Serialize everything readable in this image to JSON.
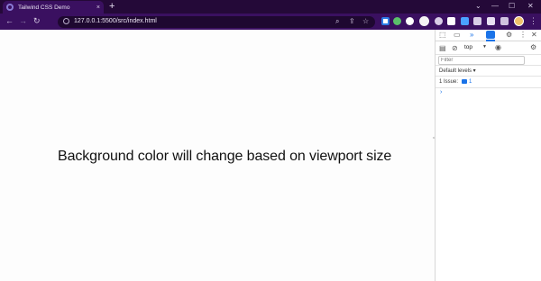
{
  "browser": {
    "tab": {
      "title": "Tailwind CSS Demo",
      "close": "×"
    },
    "new_tab": "+",
    "window_controls": {
      "chevron": "⌄",
      "minimize": "—",
      "maximize": "☐",
      "close": "✕"
    },
    "nav": {
      "back": "←",
      "forward": "→",
      "reload": "↻"
    },
    "url": "127.0.0.1:5500/src/index.html",
    "menu": "⋮"
  },
  "page": {
    "headline": "Background color will change based on viewport size"
  },
  "devtools": {
    "tabs_more": "»",
    "context": "top",
    "filter_placeholder": "Filter",
    "levels": "Default levels ▾",
    "issues_label": "1 Issue:",
    "issues_count": "1",
    "prompt": "›"
  },
  "colors": {
    "tabstrip": "#240938",
    "toolbar": "#3a1060",
    "accent": "#1a73e8",
    "page_bg": "#fdfdfd"
  }
}
